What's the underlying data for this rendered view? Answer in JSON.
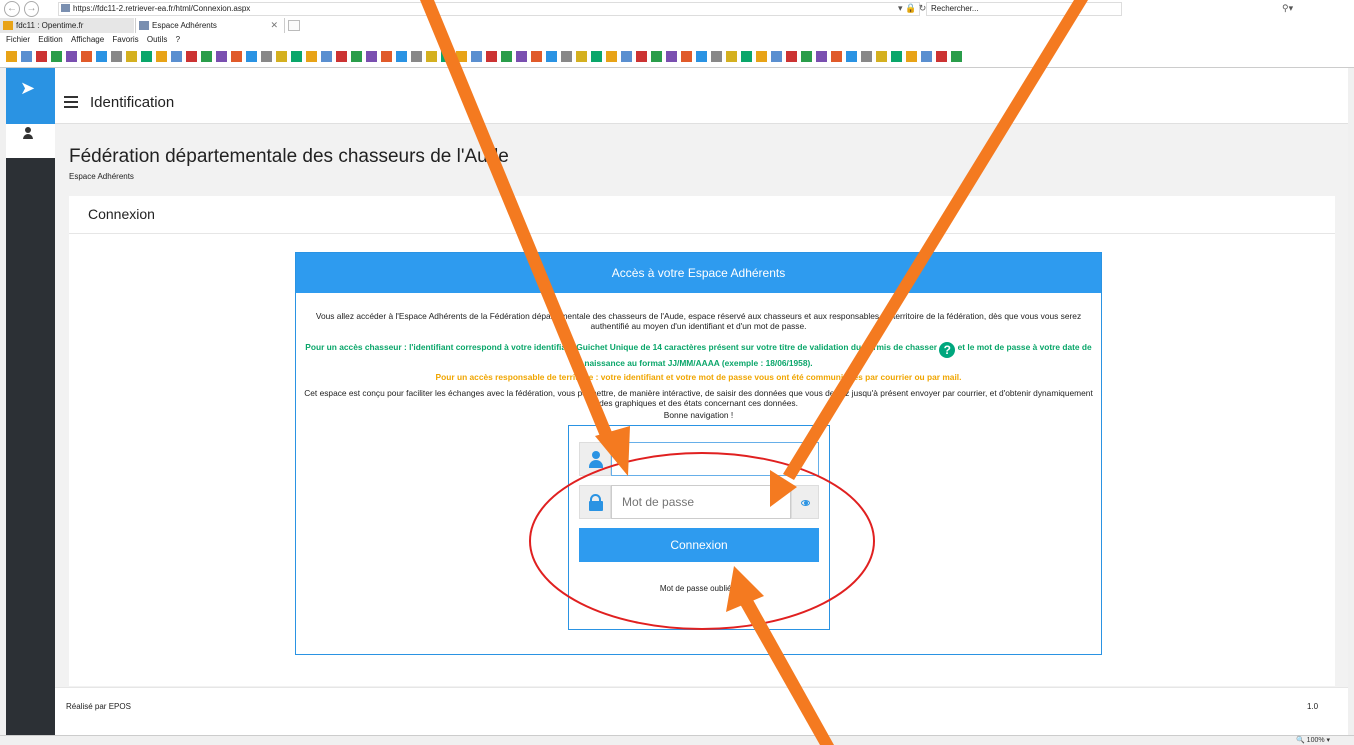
{
  "browser": {
    "url": "https://fdc11-2.retriever-ea.fr/html/Connexion.aspx",
    "search_placeholder": "Rechercher...",
    "tabs": [
      {
        "label": "fdc11 : Opentime.fr"
      },
      {
        "label": "Espace Adhérents"
      }
    ],
    "menu": [
      "Fichier",
      "Edition",
      "Affichage",
      "Favoris",
      "Outils",
      "?"
    ],
    "zoom": "100%"
  },
  "app": {
    "topbar_title": "Identification",
    "page_title": "Fédération départementale des chasseurs de l'Aude",
    "page_subtitle": "Espace Adhérents",
    "card_title": "Connexion",
    "panel": {
      "header": "Accès à votre Espace Adhérents",
      "intro": "Vous allez accéder à l'Espace Adhérents de la Fédération départementale des chasseurs de l'Aude, espace réservé aux chasseurs et aux responsables de territoire de la fédération, dès que vous vous serez authentifié au moyen d'un identifiant et d'un mot de passe.",
      "hunter_a": "Pour un accès chasseur : l'identifiant correspond à votre identifiant Guichet Unique de 14 caractères présent sur votre titre de validation du permis de chasser",
      "hunter_b": "et le mot de passe à votre date de naissance au format JJ/MM/AAAA (exemple : 18/06/1958).",
      "manager": "Pour un accès responsable de territoire : votre identifiant et votre mot de passe vous ont été communiqués par courrier ou par mail.",
      "purpose": "Cet espace est conçu pour faciliter les échanges avec la fédération, vous permettre, de manière intéractive, de saisir des données que vous deviez jusqu'à présent envoyer par courrier, et d'obtenir dynamiquement des graphiques et des états concernant ces données.",
      "bonne": "Bonne navigation !"
    },
    "login": {
      "identifier_value": "",
      "password_placeholder": "Mot de passe",
      "submit_label": "Connexion",
      "forgot_label": "Mot de passe oublié ?"
    },
    "footer_left": "Réalisé par EPOS",
    "footer_right": "1.0"
  },
  "colors": {
    "accent": "#2e9bef",
    "sidebar": "#2c3035",
    "hunter_text": "#0aa66a",
    "manager_text": "#f0a500",
    "annotation_arrow": "#f47a20",
    "annotation_circle": "#e02020"
  },
  "icons": [
    "back-arrow-icon",
    "forward-arrow-icon",
    "lock-icon",
    "refresh-icon",
    "search-icon",
    "home-icon",
    "star-icon",
    "gear-icon",
    "smiley-icon",
    "paper-plane-icon",
    "user-icon",
    "hamburger-icon",
    "help-icon",
    "person-icon",
    "padlock-icon",
    "eye-icon"
  ]
}
